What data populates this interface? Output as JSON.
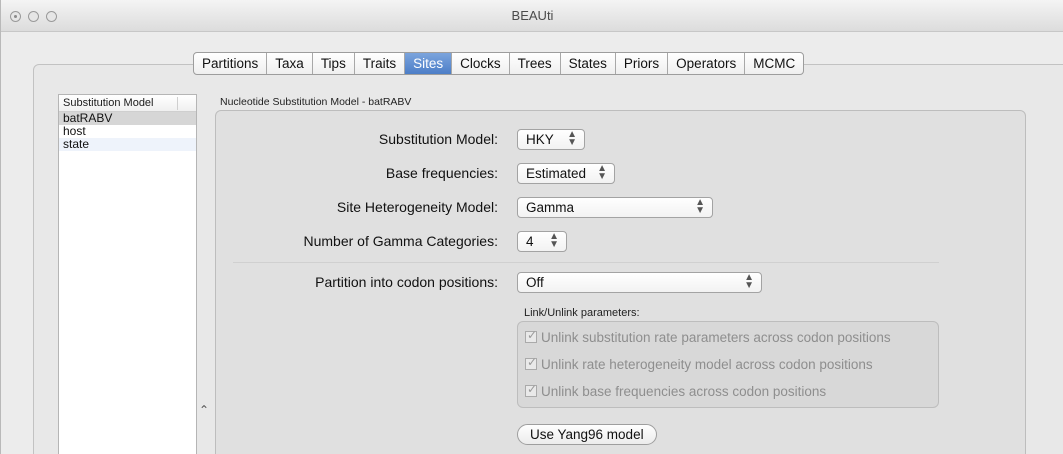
{
  "window": {
    "title": "BEAUti"
  },
  "tabs": [
    "Partitions",
    "Taxa",
    "Tips",
    "Traits",
    "Sites",
    "Clocks",
    "Trees",
    "States",
    "Priors",
    "Operators",
    "MCMC"
  ],
  "active_tab": "Sites",
  "left_list": {
    "header": "Substitution Model",
    "items": [
      "batRABV",
      "host",
      "state"
    ]
  },
  "section": {
    "title": "Nucleotide Substitution Model - batRABV"
  },
  "form": {
    "substitution_model": {
      "label": "Substitution Model:",
      "value": "HKY"
    },
    "base_frequencies": {
      "label": "Base frequencies:",
      "value": "Estimated"
    },
    "site_heterogeneity": {
      "label": "Site Heterogeneity Model:",
      "value": "Gamma"
    },
    "gamma_categories": {
      "label": "Number of Gamma Categories:",
      "value": "4"
    },
    "codon_partition": {
      "label": "Partition into codon positions:",
      "value": "Off"
    }
  },
  "link_params": {
    "label": "Link/Unlink parameters:",
    "checkboxes": [
      {
        "label": "Unlink substitution rate parameters across codon positions",
        "checked": true,
        "enabled": false
      },
      {
        "label": "Unlink rate heterogeneity model across codon positions",
        "checked": true,
        "enabled": false
      },
      {
        "label": "Unlink base frequencies across codon positions",
        "checked": true,
        "enabled": false
      }
    ]
  },
  "yang_button": "Use Yang96 model",
  "colors": {
    "active_tab": "#4c7ec7",
    "selection": "#d6d6d6"
  }
}
